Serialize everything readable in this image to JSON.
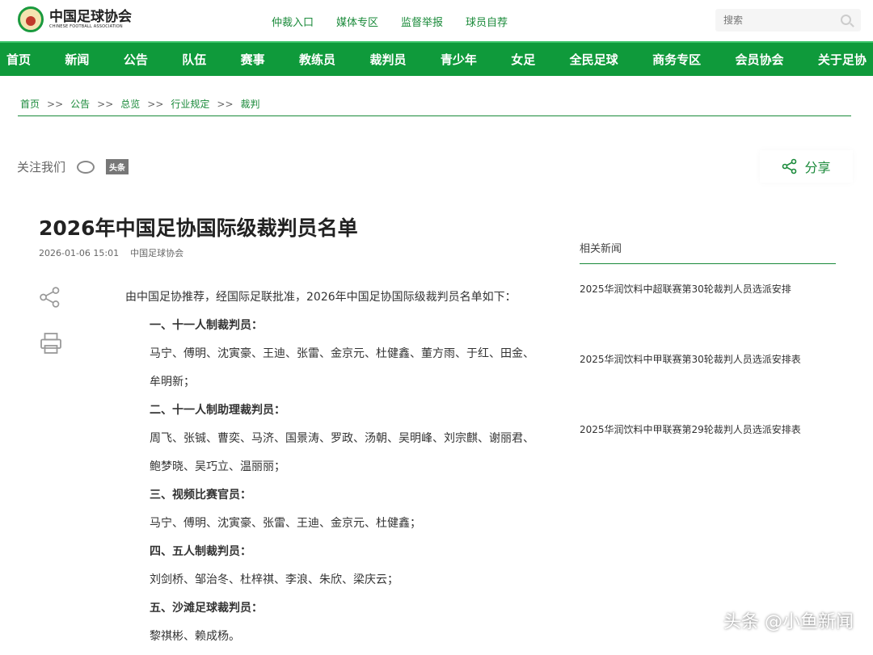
{
  "header": {
    "logo_cn": "中国足球协会",
    "logo_en": "CHINESE FOOTBALL ASSOCIATION",
    "top_links": [
      "仲裁入口",
      "媒体专区",
      "监督举报",
      "球员自荐"
    ],
    "search_placeholder": "搜索"
  },
  "nav": [
    "首页",
    "新闻",
    "公告",
    "队伍",
    "赛事",
    "教练员",
    "裁判员",
    "青少年",
    "女足",
    "全民足球",
    "商务专区",
    "会员协会",
    "关于足协"
  ],
  "breadcrumb": [
    "首页",
    "公告",
    "总览",
    "行业规定",
    "裁判"
  ],
  "breadcrumb_sep": ">>",
  "follow": {
    "label": "关注我们",
    "toutiao": "头条",
    "share": "分享"
  },
  "article": {
    "title": "2026年中国足协国际级裁判员名单",
    "date": "2026-01-06 15:01",
    "source": "中国足球协会",
    "intro": "由中国足协推荐，经国际足联批准，2026年中国足协国际级裁判员名单如下：",
    "lines": [
      {
        "text": "一、十一人制裁判员：",
        "bold": true
      },
      {
        "text": "马宁、傅明、沈寅豪、王迪、张雷、金京元、杜健鑫、董方雨、于红、田金、",
        "bold": false
      },
      {
        "text": "牟明新；",
        "bold": false
      },
      {
        "text": "二、十一人制助理裁判员：",
        "bold": true
      },
      {
        "text": "周飞、张铖、曹奕、马济、国景涛、罗政、汤朝、吴明峰、刘宗麒、谢丽君、",
        "bold": false
      },
      {
        "text": "鲍梦晓、吴巧立、温丽丽；",
        "bold": false
      },
      {
        "text": "三、视频比赛官员：",
        "bold": true
      },
      {
        "text": "马宁、傅明、沈寅豪、张雷、王迪、金京元、杜健鑫；",
        "bold": false
      },
      {
        "text": "四、五人制裁判员：",
        "bold": true
      },
      {
        "text": "刘剑桥、邹治冬、杜梓祺、李浪、朱欣、梁庆云；",
        "bold": false
      },
      {
        "text": "五、沙滩足球裁判员：",
        "bold": true
      },
      {
        "text": "黎祺彬、赖成杨。",
        "bold": false
      }
    ]
  },
  "related": {
    "heading": "相关新闻",
    "items": [
      "2025华润饮料中超联赛第30轮裁判人员选派安排",
      "2025华润饮料中甲联赛第30轮裁判人员选派安排表",
      "2025华润饮料中甲联赛第29轮裁判人员选派安排表"
    ]
  },
  "watermark": "头条 @小鱼新闻"
}
